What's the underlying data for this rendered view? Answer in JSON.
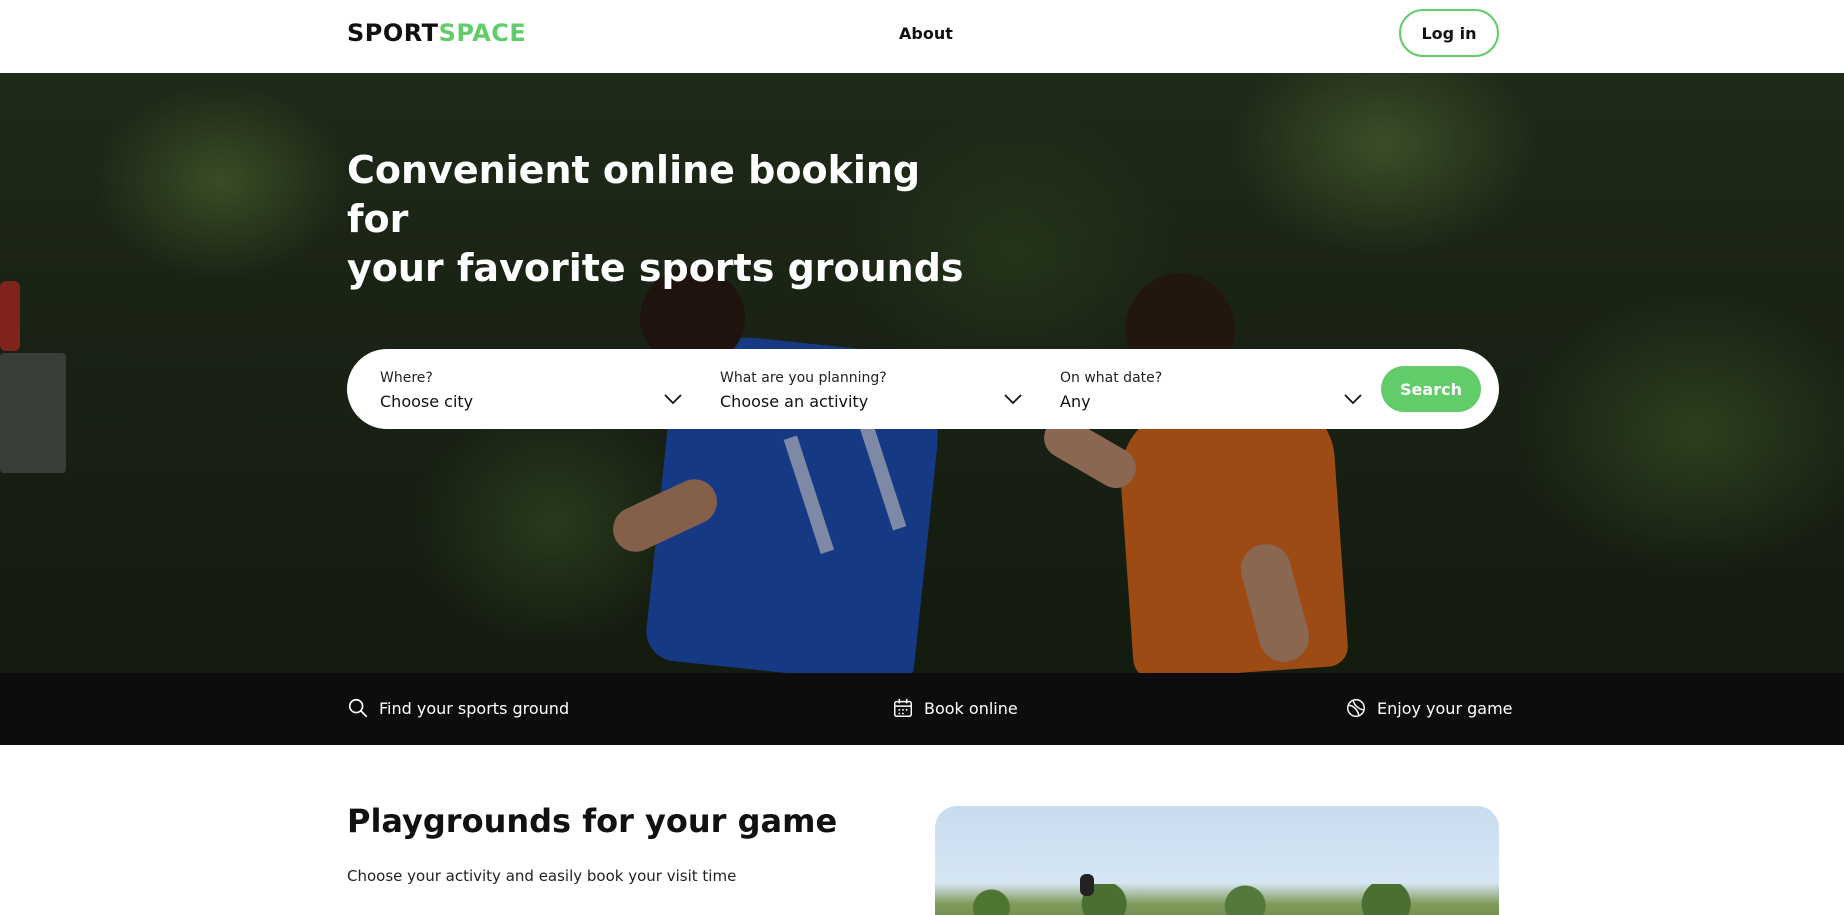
{
  "header": {
    "logo_part1": "SPORT",
    "logo_part2": "SPACE",
    "nav_about": "About",
    "login_label": "Log in"
  },
  "hero": {
    "title_line1": "Convenient online booking for",
    "title_line2": "your favorite sports grounds"
  },
  "search": {
    "where_label": "Where?",
    "where_value": "Choose city",
    "activity_label": "What are you planning?",
    "activity_value": "Choose an activity",
    "date_label": "On what date?",
    "date_value": "Any",
    "button_label": "Search"
  },
  "features": [
    {
      "label": "Find your sports ground",
      "icon": "search-icon"
    },
    {
      "label": "Book online",
      "icon": "calendar-icon"
    },
    {
      "label": "Enjoy your game",
      "icon": "ball-icon"
    }
  ],
  "section": {
    "title": "Playgrounds for your game",
    "subtitle": "Choose your activity and easily book your visit time"
  },
  "colors": {
    "accent": "#62cc6a",
    "strip_bg": "#0d0d0d",
    "text": "#111111"
  }
}
